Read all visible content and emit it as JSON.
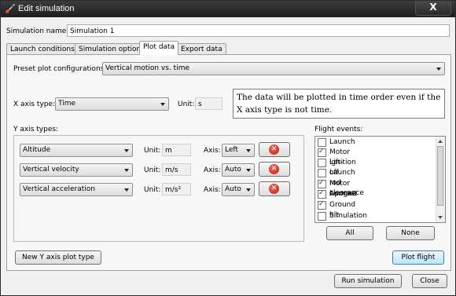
{
  "window": {
    "title": "Edit simulation",
    "close_label": "X"
  },
  "simulation": {
    "name_label": "Simulation name:",
    "name_value": "Simulation 1"
  },
  "tabs": [
    {
      "label": "Launch conditions",
      "active": false
    },
    {
      "label": "Simulation options",
      "active": false
    },
    {
      "label": "Plot data",
      "active": true
    },
    {
      "label": "Export data",
      "active": false
    }
  ],
  "plot": {
    "preset_label": "Preset plot configurations:",
    "preset_value": "Vertical motion vs. time",
    "x_axis_label": "X axis type:",
    "x_axis_value": "Time",
    "x_unit_label": "Unit:",
    "x_unit_value": "s",
    "note": "The data will be plotted in time order even if the X axis type is not time.",
    "y_axis_label": "Y axis types:",
    "y_rows": [
      {
        "type": "Altitude",
        "unit_label": "Unit:",
        "unit": "m",
        "axis_label": "Axis:",
        "axis": "Left"
      },
      {
        "type": "Vertical velocity",
        "unit_label": "Unit:",
        "unit": "m/s",
        "axis_label": "Axis:",
        "axis": "Auto"
      },
      {
        "type": "Vertical acceleration",
        "unit_label": "Unit:",
        "unit": "m/s²",
        "axis_label": "Axis:",
        "axis": "Auto"
      }
    ],
    "flight_events_label": "Flight events:",
    "flight_events": [
      {
        "label": "Launch",
        "checked": false
      },
      {
        "label": "Motor ignition",
        "checked": true
      },
      {
        "label": "Lift-off",
        "checked": false
      },
      {
        "label": "Launch rod clearance",
        "checked": false
      },
      {
        "label": "Motor burnout",
        "checked": true
      },
      {
        "label": "Apogee",
        "checked": true
      },
      {
        "label": "Ground hit",
        "checked": true
      },
      {
        "label": "Simulation end",
        "checked": false
      }
    ],
    "all_button": "All",
    "none_button": "None",
    "new_y_button": "New Y axis plot type",
    "plot_button": "Plot flight"
  },
  "footer": {
    "run_button": "Run simulation",
    "close_button": "Close"
  },
  "colors": {
    "titlebar": "#2b2b2b",
    "primary_button": "#bee6fd",
    "delete_icon": "#c8281a"
  }
}
